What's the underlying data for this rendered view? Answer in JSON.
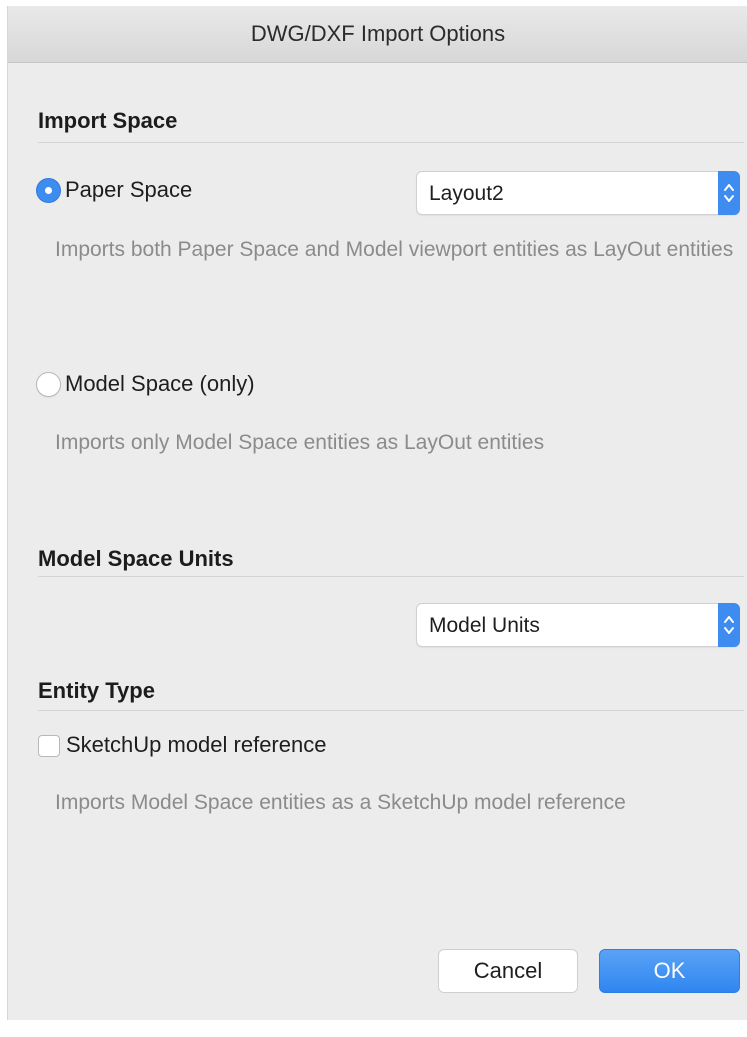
{
  "window": {
    "title": "DWG/DXF Import Options"
  },
  "import_space": {
    "heading": "Import Space",
    "paper_space": {
      "label": "Paper Space",
      "selected": true,
      "layout_popup": {
        "value": "Layout2"
      },
      "description": "Imports both Paper Space and Model viewport entities as LayOut entities"
    },
    "model_space": {
      "label": "Model Space (only)",
      "selected": false,
      "description": "Imports only Model Space entities as LayOut entities"
    }
  },
  "model_space_units": {
    "heading": "Model Space Units",
    "units_popup": {
      "value": "Model Units"
    }
  },
  "entity_type": {
    "heading": "Entity Type",
    "sketchup_reference": {
      "label": "SketchUp model reference",
      "checked": false,
      "description": "Imports Model Space entities as a SketchUp model reference"
    }
  },
  "buttons": {
    "cancel": "Cancel",
    "ok": "OK"
  },
  "colors": {
    "accent": "#3e8cf0",
    "background": "#ececec",
    "secondary_text": "#8b8b8b"
  }
}
